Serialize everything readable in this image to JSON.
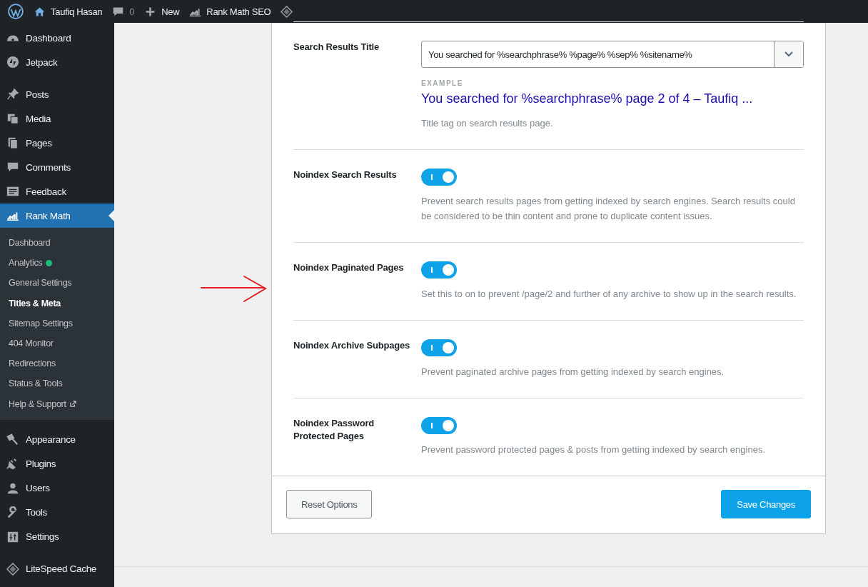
{
  "admin_bar": {
    "site_name": "Taufiq Hasan",
    "comments_count": "0",
    "new_label": "New",
    "plugin_label": "Rank Math SEO"
  },
  "sidebar": {
    "items": [
      {
        "label": "Dashboard",
        "selected": false
      },
      {
        "label": "Jetpack",
        "selected": false
      },
      {
        "kind": "separator"
      },
      {
        "label": "Posts",
        "selected": false
      },
      {
        "label": "Media",
        "selected": false
      },
      {
        "label": "Pages",
        "selected": false
      },
      {
        "label": "Comments",
        "selected": false
      },
      {
        "label": "Feedback",
        "selected": false
      },
      {
        "label": "Rank Math",
        "selected": true,
        "children": [
          {
            "label": "Dashboard",
            "selected": false
          },
          {
            "label": "Analytics",
            "selected": false,
            "color": "#1db87a"
          },
          {
            "label": "General Settings",
            "selected": false
          },
          {
            "label": "Titles & Meta",
            "selected": true
          },
          {
            "label": "Sitemap Settings",
            "selected": false
          },
          {
            "label": "404 Monitor",
            "selected": false
          },
          {
            "label": "Redirections",
            "selected": false
          },
          {
            "label": "Status & Tools",
            "selected": false
          },
          {
            "label": "Help & Support",
            "selected": false,
            "external": true
          }
        ]
      },
      {
        "kind": "separator"
      },
      {
        "label": "Appearance",
        "selected": false
      },
      {
        "label": "Plugins",
        "selected": false
      },
      {
        "label": "Users",
        "selected": false
      },
      {
        "label": "Tools",
        "selected": false
      },
      {
        "label": "Settings",
        "selected": false
      },
      {
        "kind": "separator"
      },
      {
        "label": "LiteSpeed Cache",
        "selected": false
      }
    ]
  },
  "settings": [
    {
      "kind": "select",
      "label": "Search Results Title",
      "value": "You searched for %searchphrase% %page% %sep% %sitename%",
      "example_label": "EXAMPLE",
      "example": "You searched for %searchphrase% page 2 of 4 – Taufiq ...",
      "description": "Title tag on search results page."
    },
    {
      "kind": "toggle",
      "label": "Noindex Search Results",
      "on": true,
      "description": "Prevent search results pages from getting indexed by search engines. Search results could be considered to be thin content and prone to duplicate content issues."
    },
    {
      "kind": "toggle",
      "label": "Noindex Paginated Pages",
      "on": true,
      "description": "Set this to on to prevent /page/2 and further of any archive to show up in the search results."
    },
    {
      "kind": "toggle",
      "label": "Noindex Archive Subpages",
      "on": true,
      "description": "Prevent paginated archive pages from getting indexed by search engines."
    },
    {
      "kind": "toggle",
      "label": "Noindex Password Protected Pages",
      "on": true,
      "description": "Prevent password protected pages & posts from getting indexed by search engines."
    }
  ],
  "footer": {
    "reset_button": "Reset Options",
    "save_button": "Save Changes"
  }
}
